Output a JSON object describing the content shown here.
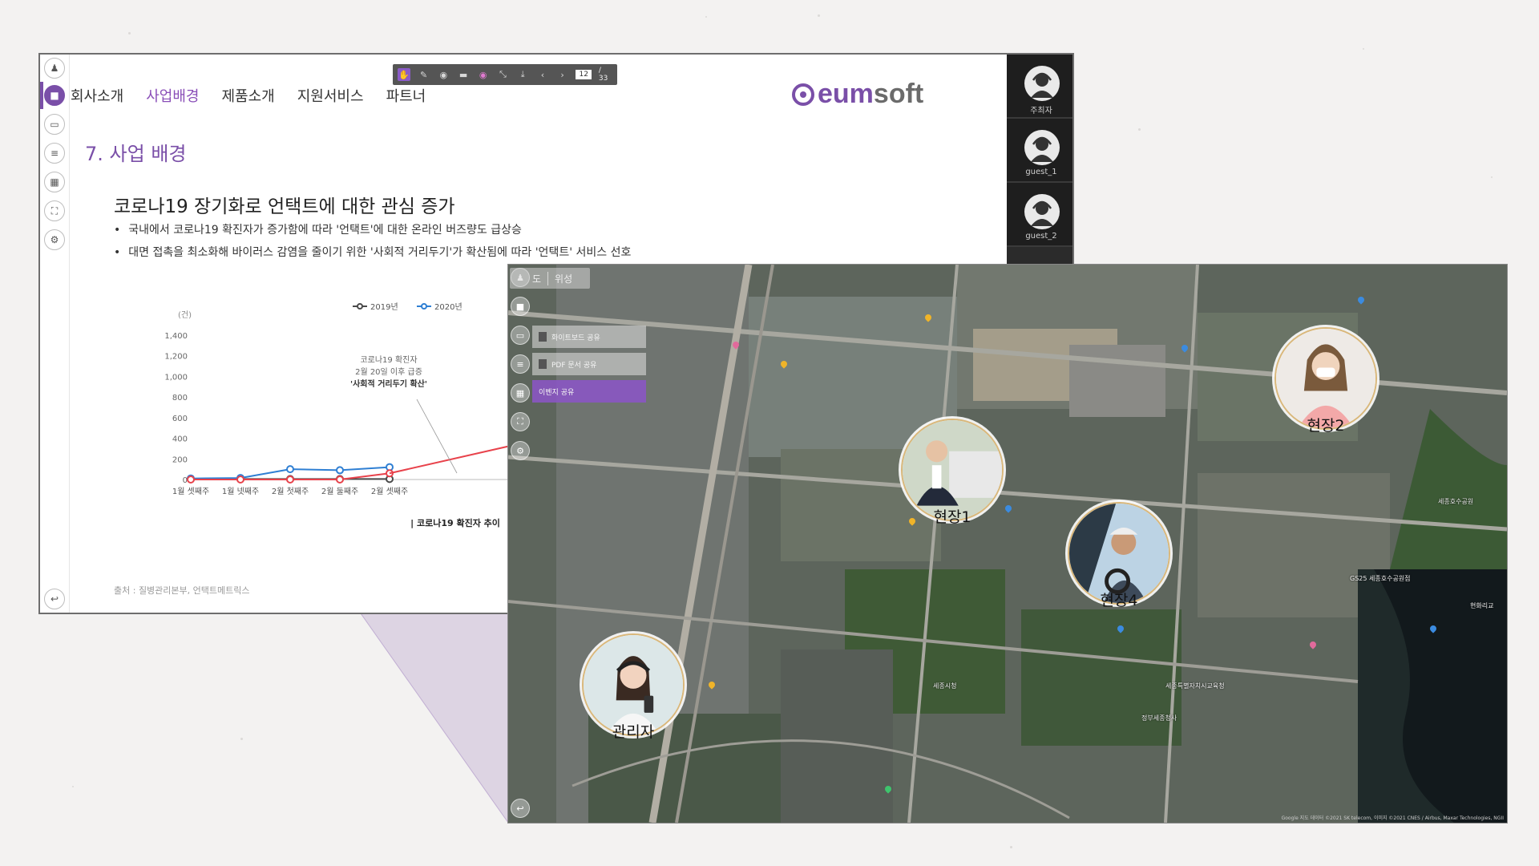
{
  "colors": {
    "accent": "#7a4fa8",
    "accent_light": "#8a4fb8",
    "series_2019": "#4a4a4a",
    "series_2020": "#2f7fd3",
    "series_covid": "#e8424b",
    "marker_ring": "#d9b77a"
  },
  "presentation": {
    "sidebar_icons": [
      "add-user-icon",
      "lock-icon",
      "screen-share-icon",
      "list-icon",
      "map-icon",
      "fullscreen-icon",
      "settings-icon",
      "exit-icon"
    ],
    "toolbar": {
      "icons": [
        "pointer-icon",
        "pen-icon",
        "eraser-icon",
        "trash-icon",
        "color-icon",
        "fit-icon",
        "download-icon",
        "prev-icon",
        "next-icon"
      ],
      "page_current": "12",
      "page_total": "/ 33"
    },
    "nav": [
      "회사소개",
      "사업배경",
      "제품소개",
      "지원서비스",
      "파트너"
    ],
    "nav_active": "사업배경",
    "brand": "eumsoft",
    "section_title": "7. 사업 배경",
    "headline": "코로나19 장기화로 언택트에 대한 관심 증가",
    "bullets": [
      "국내에서 코로나19 확진자가 증가함에 따라 '언택트'에 대한 온라인 버즈량도 급상승",
      "대면 접촉을 최소화해 바이러스 감염을 줄이기 위한 '사회적 거리두기'가 확산됨에 따라 '언택트' 서비스 선호"
    ],
    "chart_caption": "| 코로나19 확진자 추이",
    "source": "출처 : 질병관리본부, 언택트메트릭스"
  },
  "chart_data": {
    "type": "line",
    "ylabel": "(건)",
    "yticks": [
      0,
      200,
      400,
      600,
      800,
      1000,
      1200,
      1400
    ],
    "ylim": [
      0,
      1400
    ],
    "categories": [
      "1월 셋째주",
      "1월 넷째주",
      "2월 첫째주",
      "2월 둘째주",
      "2월 셋째주"
    ],
    "series": [
      {
        "name": "2019년",
        "values": [
          5,
          5,
          5,
          5,
          5
        ]
      },
      {
        "name": "2020년",
        "values": [
          10,
          15,
          100,
          90,
          120
        ]
      },
      {
        "name": "",
        "values": [
          0,
          0,
          0,
          0,
          60
        ]
      }
    ],
    "annotation": [
      "코로나19 확진자",
      "2월 20일 이후 급증",
      "'사회적 거리두기 확산'"
    ],
    "legend": "top-right"
  },
  "participants": [
    {
      "name": "주최자"
    },
    {
      "name": "guest_1"
    },
    {
      "name": "guest_2"
    }
  ],
  "map": {
    "tabs": [
      "도",
      "위성"
    ],
    "share_menu": [
      {
        "label": "화이트보드 공유",
        "active": false
      },
      {
        "label": "PDF 문서 공유",
        "active": false
      },
      {
        "label": "이벤지 공유",
        "active": true
      }
    ],
    "sidebar_icons": [
      "add-user-icon",
      "lock-icon",
      "screen-share-icon",
      "list-icon",
      "map-icon",
      "fullscreen-icon",
      "settings-icon",
      "exit-icon"
    ],
    "markers": [
      {
        "label": "현장1",
        "icon": "person-with-car-photo"
      },
      {
        "label": "현장2",
        "icon": "person-with-mask-photo"
      },
      {
        "label": "현장4",
        "icon": "truck-driver-photo"
      },
      {
        "label": "관리자",
        "icon": "woman-with-phone-photo"
      }
    ],
    "poi_labels": [
      "세종호수공원",
      "GS25 세종호수공원점",
      "현화리교",
      "세종시청",
      "세종특별자치시교육청",
      "정부세종청사"
    ],
    "attribution": "Google 지도 데이터 ©2021 SK telecom, 이미지 ©2021 CNES / Airbus, Maxar Technologies, NGII"
  }
}
